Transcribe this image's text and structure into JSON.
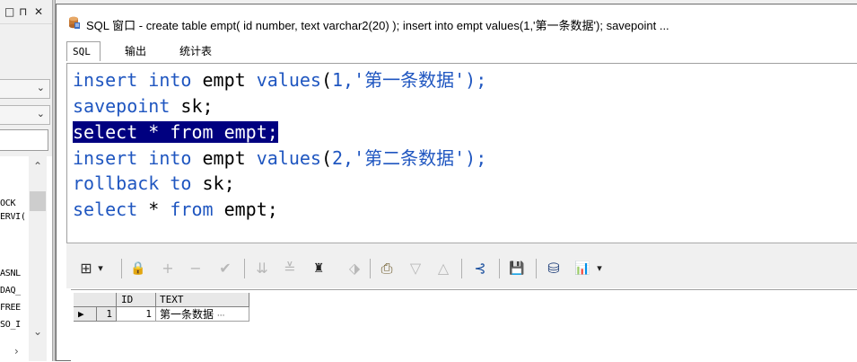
{
  "left_panel": {
    "window_buttons": [
      "□",
      "⊓",
      "✕"
    ],
    "combo_arrow": "⌄",
    "objects": [
      "OCK",
      "ERVI(",
      "ASNL",
      "DAQ_",
      "FREE",
      "SO_I"
    ],
    "scroll_up": "⌃",
    "scroll_down": "⌄",
    "scroll_right": "›"
  },
  "window": {
    "title": "SQL 窗口 - create table empt( id number, text varchar2(20) ); insert into empt values(1,'第一条数据'); savepoint ..."
  },
  "tabs": [
    {
      "label": "SQL",
      "selected": true
    },
    {
      "label": "输出",
      "selected": false
    },
    {
      "label": "统计表",
      "selected": false
    }
  ],
  "editor": {
    "lines": [
      {
        "t1": "insert into",
        "t2": " empt ",
        "t3": "values",
        "t4": "(",
        "t5": "1",
        "t6": ",'第一条数据');"
      },
      {
        "t1": "savepoint",
        "t2": " sk;"
      },
      {
        "text": "select * from empt;",
        "selected": true
      },
      {
        "t1": "insert into",
        "t2": " empt ",
        "t3": "values",
        "t4": "(",
        "t5": "2",
        "t6": ",'第二条数据');"
      },
      {
        "t1": "rollback to",
        "t2": " sk;"
      },
      {
        "t1": "select",
        "t2": " * ",
        "t3": "from",
        "t4": " empt;"
      }
    ]
  },
  "grid_toolbar": {
    "icons": [
      "grid-icon",
      "lock-icon",
      "plus-icon",
      "minus-icon",
      "check-icon",
      "filter-down-icon",
      "filter-clear-icon",
      "find-icon",
      "eraser-icon",
      "print-icon",
      "triangle-down-icon",
      "triangle-up-icon",
      "tree-icon",
      "save-icon",
      "export-icon",
      "chart-icon"
    ],
    "glyphs": {
      "grid": "⊞",
      "dropdown": "▾",
      "lock": "🔒",
      "plus": "+",
      "minus": "−",
      "check": "✔",
      "filter_down": "⇊",
      "filter_clear": "≚",
      "find": "♜",
      "eraser": "⬗",
      "print": "⎙",
      "triangle_down": "▽",
      "triangle_up": "△",
      "tree": "⊰",
      "save": "💾",
      "export": "⛁",
      "chart": "📊"
    }
  },
  "result_grid": {
    "columns": [
      "ID",
      "TEXT"
    ],
    "rows": [
      {
        "indicator": "▶",
        "rownum": "1",
        "id": "1",
        "text": "第一条数据",
        "ellipsis": "···"
      }
    ]
  },
  "colors": {
    "keyword": "#1f56c0",
    "selection": "#000080"
  }
}
